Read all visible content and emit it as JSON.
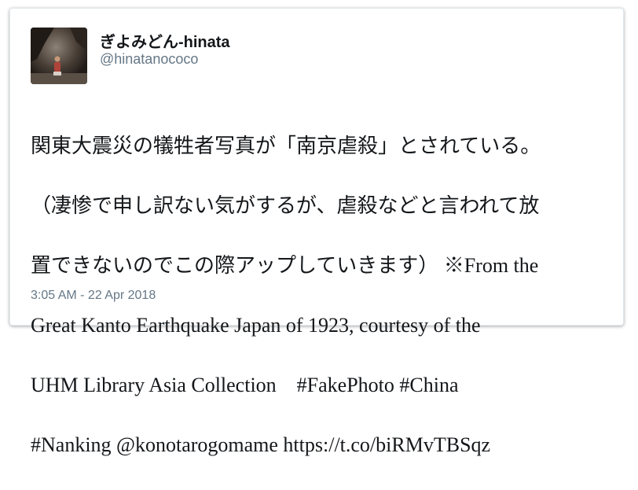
{
  "tweet": {
    "author": {
      "display_name": "ぎよみどん-hinata",
      "handle": "@hinatanococo",
      "avatar": "profile-photo"
    },
    "text_lines": [
      "関東大震災の犠牲者写真が「南京虐殺」とされている。",
      "（凄惨で申し訳ない気がするが、虐殺などと言われて放",
      "置できないのでこの際アップしていきます） ※From the",
      "Great Kanto Earthquake Japan of 1923, courtesy of the",
      "UHM Library Asia Collection　#FakePhoto #China",
      "#Nanking @konotarogomame https://t.co/biRMvTBSqz"
    ],
    "timestamp": "3:05 AM - 22 Apr 2018"
  }
}
